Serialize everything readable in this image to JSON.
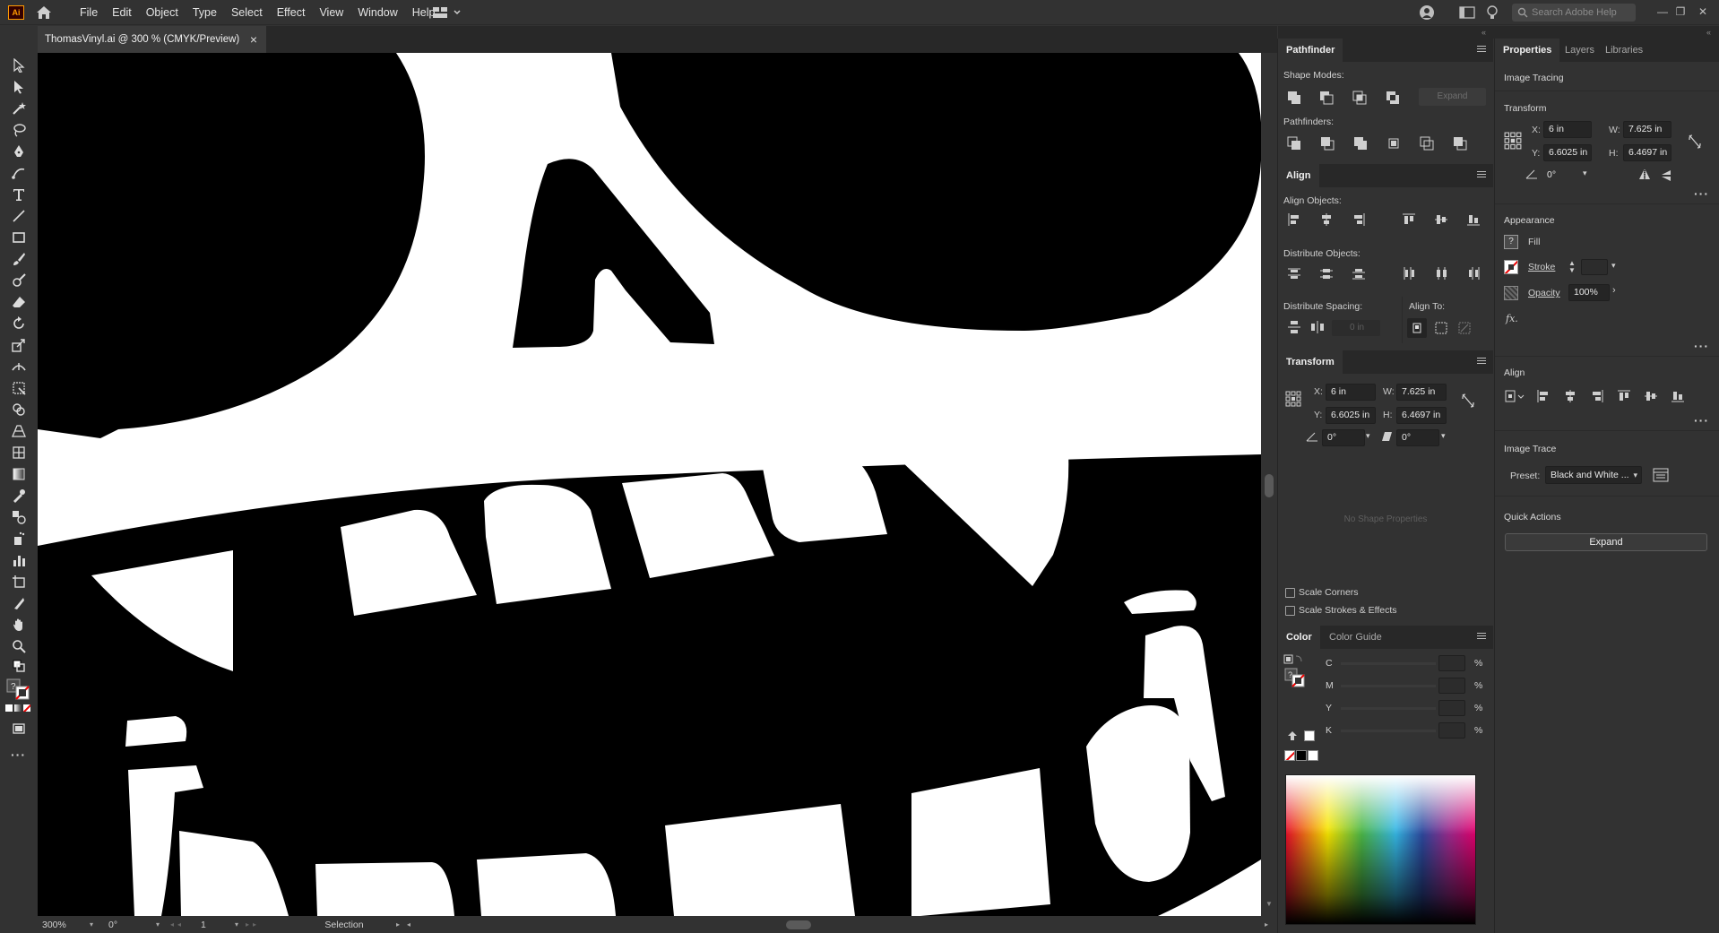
{
  "app": {
    "logo": "Ai",
    "menu": [
      "File",
      "Edit",
      "Object",
      "Type",
      "Select",
      "Effect",
      "View",
      "Window",
      "Help"
    ],
    "search_placeholder": "Search Adobe Help"
  },
  "document": {
    "tab_title": "ThomasVinyl.ai @ 300 % (CMYK/Preview)",
    "close_glyph": "×"
  },
  "status": {
    "zoom": "300%",
    "rotation": "0°",
    "artboard": "1",
    "tool": "Selection"
  },
  "pathfinder": {
    "tab": "Pathfinder",
    "shape_modes_label": "Shape Modes:",
    "expand_label": "Expand",
    "pathfinders_label": "Pathfinders:"
  },
  "align": {
    "tab": "Align",
    "align_objects_label": "Align Objects:",
    "distribute_objects_label": "Distribute Objects:",
    "distribute_spacing_label": "Distribute Spacing:",
    "align_to_label": "Align To:",
    "spacing_value": "0 in"
  },
  "transform": {
    "tab": "Transform",
    "x_label": "X:",
    "x": "6 in",
    "y_label": "Y:",
    "y": "6.6025 in",
    "w_label": "W:",
    "w": "7.625 in",
    "h_label": "H:",
    "h": "6.4697 in",
    "angle": "0°",
    "shear": "0°",
    "no_shape_props": "No Shape Properties",
    "scale_corners": "Scale Corners",
    "scale_strokes": "Scale Strokes & Effects"
  },
  "color": {
    "tab": "Color",
    "guide_tab": "Color Guide",
    "channels": [
      {
        "label": "C",
        "unit": "%"
      },
      {
        "label": "M",
        "unit": "%"
      },
      {
        "label": "Y",
        "unit": "%"
      },
      {
        "label": "K",
        "unit": "%"
      }
    ]
  },
  "properties": {
    "tabs": [
      "Properties",
      "Layers",
      "Libraries"
    ],
    "section_title": "Image Tracing",
    "transform_title": "Transform",
    "x": "6 in",
    "y": "6.6025 in",
    "w": "7.625 in",
    "h": "6.4697 in",
    "x_label": "X:",
    "y_label": "Y:",
    "w_label": "W:",
    "h_label": "H:",
    "angle": "0°",
    "appearance_title": "Appearance",
    "fill_label": "Fill",
    "stroke_label": "Stroke",
    "opacity_label": "Opacity",
    "opacity_value": "100%",
    "fx_label": "fx.",
    "align_title": "Align",
    "image_trace_title": "Image Trace",
    "preset_label": "Preset:",
    "preset_value": "Black and White ...",
    "quick_actions_title": "Quick Actions",
    "expand_button": "Expand"
  }
}
